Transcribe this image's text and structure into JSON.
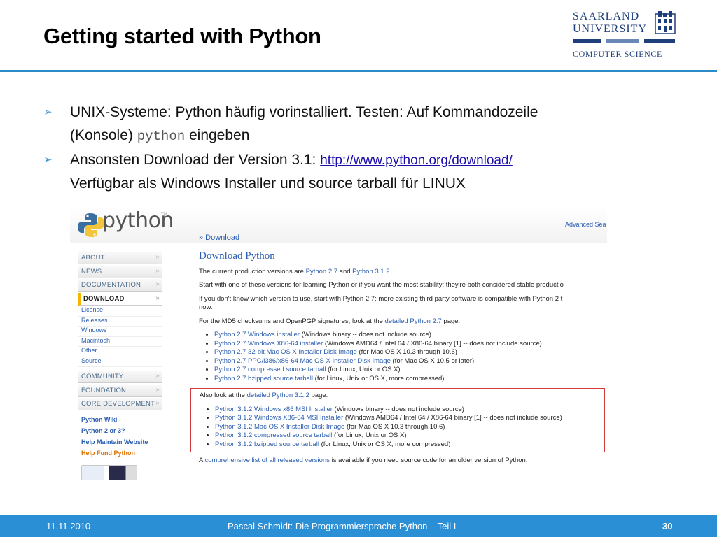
{
  "slide": {
    "title": "Getting started with Python"
  },
  "logo": {
    "line1": "SAARLAND",
    "line2": "UNIVERSITY",
    "line3": "COMPUTER SCIENCE"
  },
  "bullets": {
    "b1_text": "UNIX-Systeme: Python häufig vorinstalliert.  Testen: Auf Kommandozeile",
    "b1_line2_pre": "(Konsole) ",
    "b1_code": "python",
    "b1_line2_post": " eingeben",
    "b2_text": "Ansonsten Download der Version 3.1: ",
    "b2_link": "http://www.python.org/download/",
    "b3_text": "Verfügbar als  Windows Installer und source tarball für LINUX"
  },
  "screenshot": {
    "logo_text": "python",
    "tm": "TM",
    "advanced_search": "Advanced Sea",
    "breadcrumb": "» Download",
    "sidebar_main": [
      "ABOUT",
      "NEWS",
      "DOCUMENTATION",
      "DOWNLOAD"
    ],
    "sidebar_sub": [
      "License",
      "Releases",
      "Windows",
      "Macintosh",
      "Other",
      "Source"
    ],
    "sidebar_more": [
      "COMMUNITY",
      "FOUNDATION",
      "CORE DEVELOPMENT"
    ],
    "sidebar_links": [
      "Python Wiki",
      "Python 2 or 3?",
      "Help Maintain Website",
      "Help Fund Python"
    ],
    "heading": "Download Python",
    "p1_pre": "The current production versions are ",
    "p1_l1": "Python 2.7",
    "p1_mid": " and ",
    "p1_l2": "Python 3.1.2",
    "p1_post": ".",
    "p2": "Start with one of these versions for learning Python or if you want the most stability; they're both considered stable productio",
    "p3a": "If you don't know which version to use, start with Python 2.7; more existing third party software is compatible with Python 2 t",
    "p3b": "now.",
    "p4_pre": "For the MD5 checksums and OpenPGP signatures, look at the ",
    "p4_link": "detailed Python 2.7",
    "p4_post": " page:",
    "list27": [
      {
        "link": "Python 2.7 Windows installer",
        "rest": " (Windows binary -- does not include source)"
      },
      {
        "link": "Python 2.7 Windows X86-64 installer",
        "rest": " (Windows AMD64 / Intel 64 / X86-64 binary [1] -- does not include source)"
      },
      {
        "link": "Python 2.7 32-bit Mac OS X Installer Disk Image",
        "rest": " (for Mac OS X 10.3 through 10.6)"
      },
      {
        "link": "Python 2.7 PPC/i386/x86-64 Mac OS X Installer Disk Image",
        "rest": " (for Mac OS X 10.5 or later)"
      },
      {
        "link": "Python 2.7 compressed source tarball",
        "rest": " (for Linux, Unix or OS X)"
      },
      {
        "link": "Python 2.7 bzipped source tarball",
        "rest": " (for Linux, Unix or OS X, more compressed)"
      }
    ],
    "p5_pre": "Also look at the ",
    "p5_link": "detailed Python 3.1.2",
    "p5_post": " page:",
    "list312": [
      {
        "link": "Python 3.1.2 Windows x86 MSI Installer",
        "rest": " (Windows binary -- does not include source)"
      },
      {
        "link": "Python 3.1.2 Windows X86-64 MSI Installer",
        "rest": " (Windows AMD64 / Intel 64 / X86-64 binary [1] -- does not include source)"
      },
      {
        "link": "Python 3.1.2 Mac OS X Installer Disk Image",
        "rest": " (for Mac OS X 10.3 through 10.6)"
      },
      {
        "link": "Python 3.1.2 compressed source tarball",
        "rest": " (for Linux, Unix or OS X)"
      },
      {
        "link": "Python 3.1.2 bzipped source tarball",
        "rest": " (for Linux, Unix or OS X, more compressed)"
      }
    ],
    "p6_pre": "A ",
    "p6_link": "comprehensive list of all released versions",
    "p6_post": " is available if you need source code for an older version of Python."
  },
  "footer": {
    "date": "11.11.2010",
    "title": "Pascal Schmidt: Die Programmiersprache Python – Teil I",
    "page": "30"
  },
  "colors": {
    "accent": "#2b8fd6",
    "logo_blue": "#1f3f7a",
    "highlight_box": "#d23b3b"
  }
}
